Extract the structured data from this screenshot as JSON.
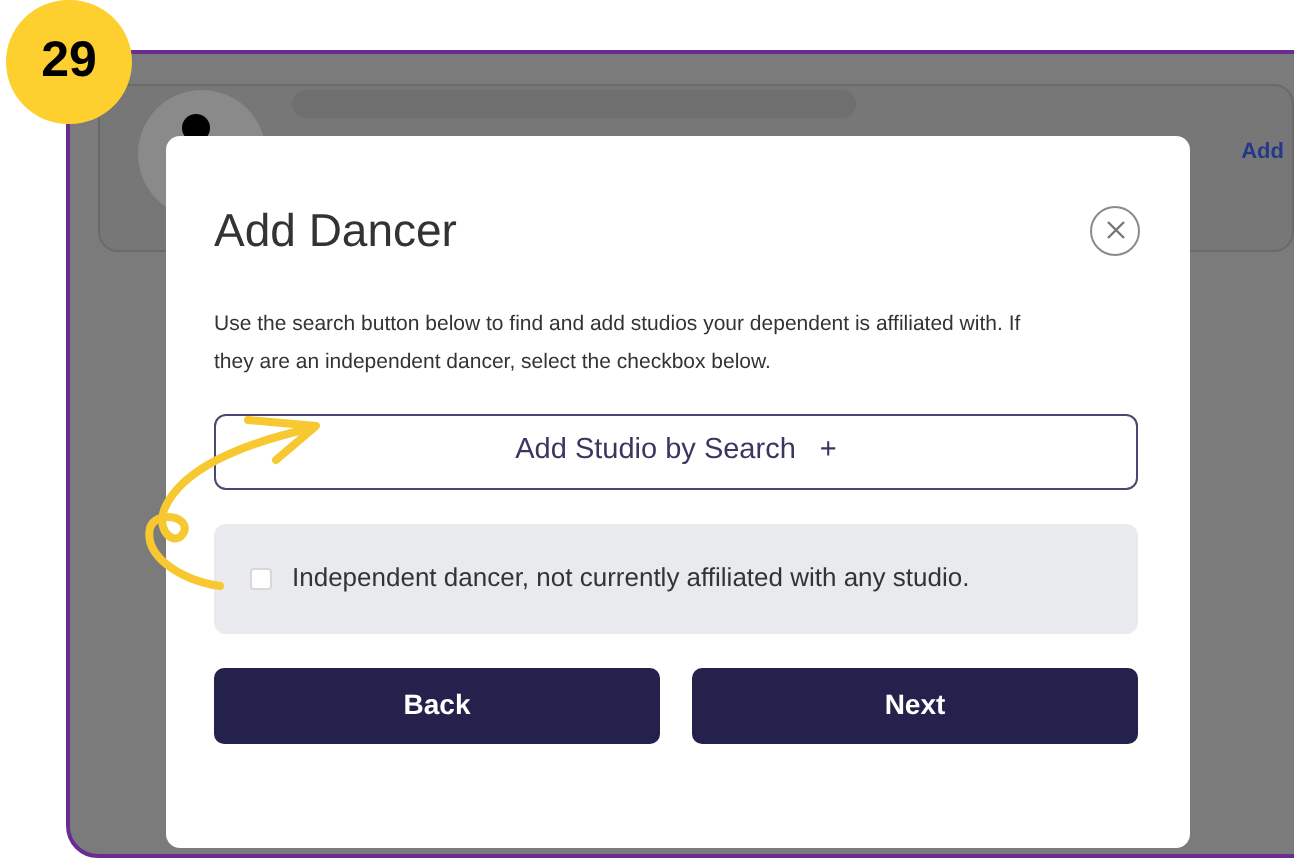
{
  "step_badge": "29",
  "background_card": {
    "link": "Add"
  },
  "dialog": {
    "title": "Add Dancer",
    "description": "Use the search button below to find and add studios your dependent is affiliated with. If they are an independent dancer, select the checkbox below.",
    "search_button": {
      "label": "Add Studio by Search",
      "icon": "+"
    },
    "checkbox": {
      "label": "Independent dancer, not currently affiliated with any studio.",
      "checked": false
    },
    "buttons": [
      "Back",
      "Next"
    ]
  }
}
